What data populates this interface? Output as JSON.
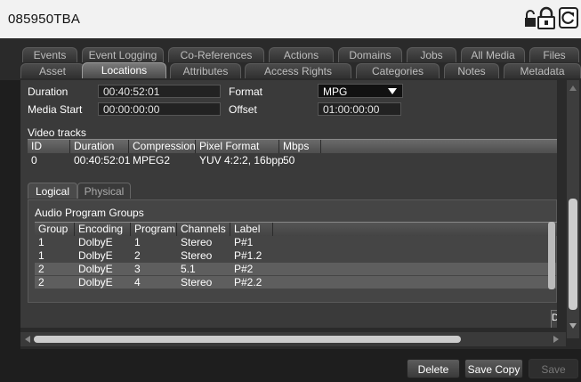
{
  "window": {
    "title": "085950TBA"
  },
  "tabs_row1": [
    {
      "label": "Events"
    },
    {
      "label": "Event Logging"
    },
    {
      "label": "Co-References"
    },
    {
      "label": "Actions"
    },
    {
      "label": "Domains"
    },
    {
      "label": "Jobs"
    },
    {
      "label": "All Media"
    },
    {
      "label": "Files"
    }
  ],
  "tabs_row2": [
    {
      "label": "Asset"
    },
    {
      "label": "Locations"
    },
    {
      "label": "Attributes"
    },
    {
      "label": "Access Rights"
    },
    {
      "label": "Categories"
    },
    {
      "label": "Notes"
    },
    {
      "label": "Metadata"
    }
  ],
  "fields": {
    "duration": {
      "label": "Duration",
      "value": "00:40:52:01"
    },
    "media_start": {
      "label": "Media Start",
      "value": "00:00:00:00"
    },
    "format": {
      "label": "Format",
      "value": "MPG"
    },
    "offset": {
      "label": "Offset",
      "value": "01:00:00:00"
    }
  },
  "video_tracks": {
    "title": "Video tracks",
    "columns": [
      "ID",
      "Duration",
      "Compression",
      "Pixel Format",
      "Mbps"
    ],
    "rows": [
      [
        "0",
        "00:40:52:01",
        "MPEG2",
        "YUV 4:2:2, 16bpp",
        "50"
      ]
    ]
  },
  "subtabs": [
    {
      "label": "Logical"
    },
    {
      "label": "Physical"
    }
  ],
  "audio_groups": {
    "title": "Audio Program Groups",
    "columns": [
      "Group",
      "Encoding",
      "Program",
      "Channels",
      "Label"
    ],
    "rows": [
      [
        "1",
        "DolbyE",
        "1",
        "Stereo",
        "P#1"
      ],
      [
        "1",
        "DolbyE",
        "2",
        "Stereo",
        "P#1.2"
      ],
      [
        "2",
        "DolbyE",
        "3",
        "5.1",
        "P#2"
      ],
      [
        "2",
        "DolbyE",
        "4",
        "Stereo",
        "P#2.2"
      ]
    ]
  },
  "partial_button": {
    "label": "De"
  },
  "footer": {
    "delete": "Delete",
    "save_copy": "Save Copy",
    "save": "Save"
  },
  "colors": {
    "title_bg": "#f2f2f2",
    "panel": "#3a3a3a",
    "selected_row": "#5e5e5e"
  },
  "icons": [
    "lock-open-icon",
    "lock-icon",
    "refresh-icon"
  ]
}
